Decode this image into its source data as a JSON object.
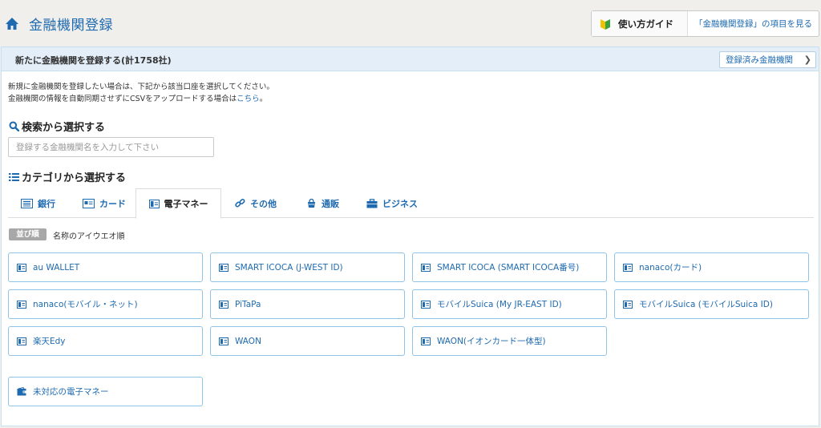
{
  "header": {
    "title": "金融機関登録",
    "guide_label": "使い方ガイド",
    "guide_link": "「金融機関登録」の項目を見る"
  },
  "panel": {
    "title": "新たに金融機関を登録する(計1758社)",
    "registered_button": "登録済み金融機関",
    "intro_line1": "新規に金融機関を登録したい場合は、下記から該当口座を選択してください。",
    "intro_line2_prefix": "金融機関の情報を自動同期させずにCSVをアップロードする場合は",
    "intro_line2_link": "こちら",
    "intro_line2_suffix": "。"
  },
  "search": {
    "title": "検索から選択する",
    "placeholder": "登録する金融機関名を入力して下さい"
  },
  "category": {
    "title": "カテゴリから選択する",
    "tabs": [
      {
        "label": "銀行",
        "icon": "bank-icon"
      },
      {
        "label": "カード",
        "icon": "card-icon"
      },
      {
        "label": "電子マネー",
        "icon": "emoney-icon",
        "active": true
      },
      {
        "label": "その他",
        "icon": "link-icon"
      },
      {
        "label": "通販",
        "icon": "shop-icon"
      },
      {
        "label": "ビジネス",
        "icon": "briefcase-icon"
      }
    ]
  },
  "sort": {
    "badge": "並び順",
    "label": "名称のアイウエオ順"
  },
  "institutions": [
    "au WALLET",
    "SMART ICOCA (J-WEST ID)",
    "SMART ICOCA (SMART ICOCA番号)",
    "nanaco(カード)",
    "nanaco(モバイル・ネット)",
    "PiTaPa",
    "モバイルSuica (My JR-EAST ID)",
    "モバイルSuica (モバイルSuica ID)",
    "楽天Edy",
    "WAON",
    "WAON(イオンカード一体型)"
  ],
  "unsupported": "未対応の電子マネー",
  "colors": {
    "accent": "#1e6ab0",
    "button_border": "#8fc4e6",
    "panel_header": "#e3eef8"
  }
}
